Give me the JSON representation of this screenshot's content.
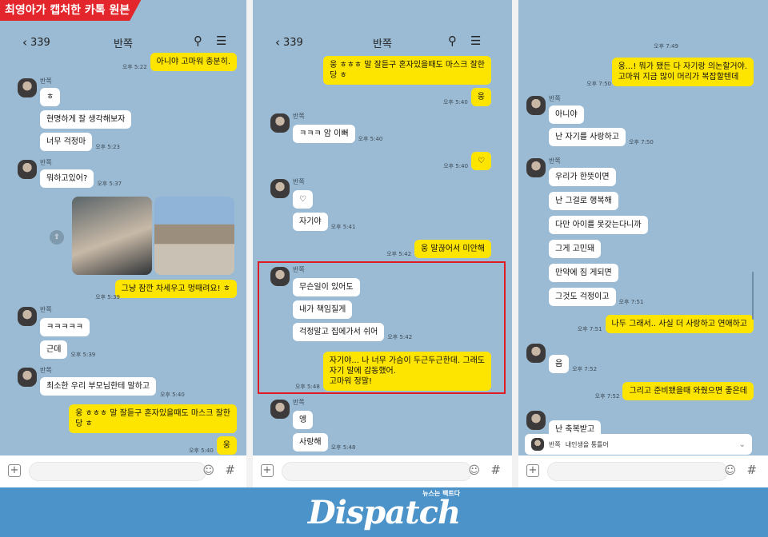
{
  "header_badge": "최영아가 캡처한 카톡 원본",
  "chat": {
    "back_count": "339",
    "title": "반쪽"
  },
  "icons": {
    "back": "chevron-left-icon",
    "search": "search-icon",
    "menu": "hamburger-menu-icon",
    "plus": "plus-icon",
    "emoji": "emoji-icon",
    "hash": "hash-icon"
  },
  "p1": {
    "m": [
      "아니야 고마워 충분히.",
      "ㅎ",
      "현명하게 잘 생각해보자",
      "너무 걱정마",
      "뭐하고있어?",
      "그냥 잠깐 차세우고 멍때려요! ㅎ",
      "ㅋㅋㅋㅋㅋ",
      "근데",
      "최소한 우리 부모님한테 말하고",
      "웅 ㅎㅎㅎ 말 잘듣구 혼자있을때도 마스크 잘한\n당 ㅎ",
      "웅"
    ],
    "t": [
      "오후 5:22",
      "오후 5:23",
      "오후 5:37",
      "오후 5:39",
      "오후 5:39",
      "오후 5:40",
      "오후 5:40"
    ],
    "sender": "반쪽"
  },
  "p2": {
    "m": [
      "웅 ㅎㅎㅎ 말 잘듣구 혼자있을때도 마스크 잘한\n당 ㅎ",
      "웅",
      "ㅋㅋㅋ 암 이뻐",
      "♡",
      "♡",
      "자기야",
      "웅 말끊어서 미안해",
      "무슨일이 있어도",
      "내가 책임질게",
      "걱정말고 집에가서 쉬어",
      "자기야... 나 너무 가슴이 두근두근한데. 그래도\n자기 말에 감동했어.\n고마워 정말!",
      "엥",
      "사랑해"
    ],
    "t": [
      "오후 5:40",
      "오후 5:40",
      "오후 5:40",
      "오후 5:41",
      "오후 5:42",
      "오후 5:42",
      "오후 5:48",
      "오후 5:48"
    ],
    "sender": "반쪽"
  },
  "p3": {
    "m": [
      "웅...! 뭐가 됐든 다 자기랑 의논할거야.\n고마워 지금 많이 머리가 복잡할텐데",
      "아니야",
      "난 자기를 사랑하고",
      "우리가 한뜻이면",
      "난 그걸로 행복해",
      "다만 아이를 못갖는다니까",
      "그게 고민돼",
      "만약에 짐 게되면",
      "그것도 걱정이고",
      "나두 그래서.. 사실 더 사랑하고 연애하고",
      "음",
      "그리고 준비됐을때 와줬으면 좋은데",
      "난 축복받고"
    ],
    "t": [
      "오후 7:49",
      "오후 7:50",
      "오후 7:50",
      "오후 7:51",
      "오후 7:51",
      "오후 7:52",
      "오후 7:52"
    ],
    "sender": "반쪽",
    "notice_sender": "반쪽",
    "notice_text": "내인생을 통틀어"
  },
  "footer": {
    "logo": "Dispatch",
    "tagline": "뉴스는 팩트다"
  }
}
